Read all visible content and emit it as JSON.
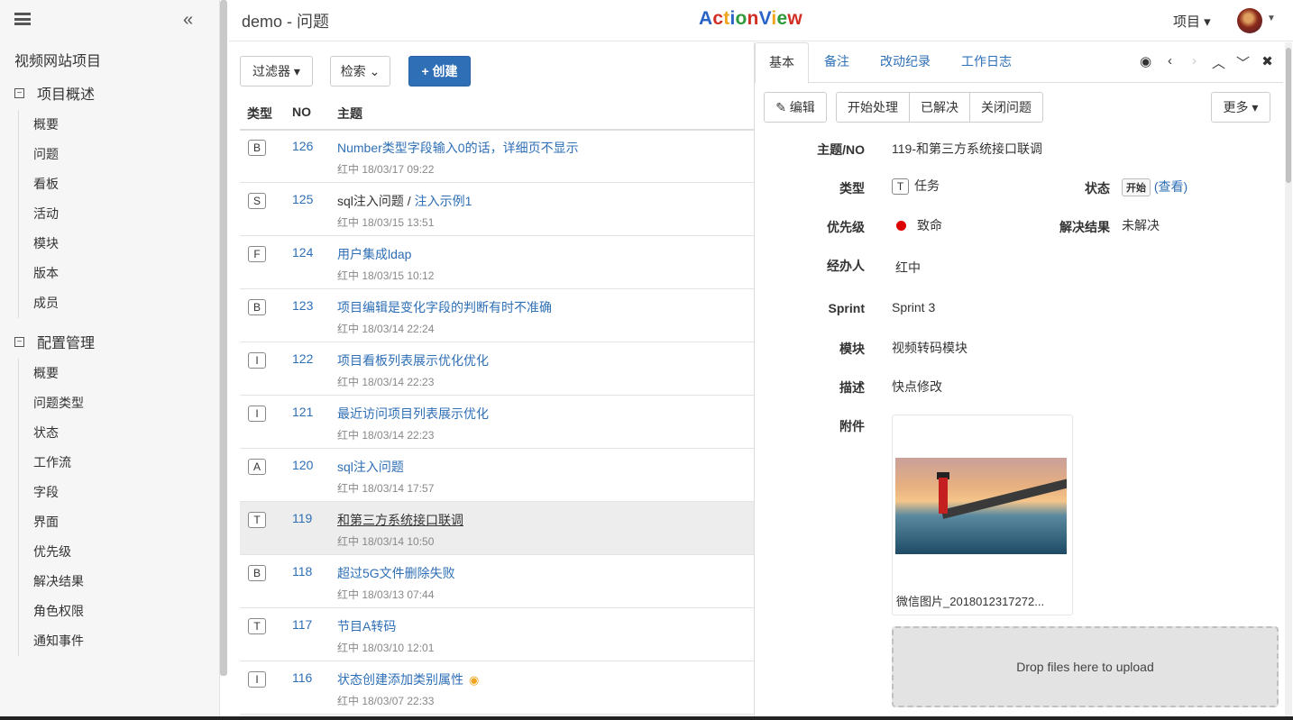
{
  "sidebar": {
    "project_name": "视频网站项目",
    "groups": [
      {
        "label": "项目概述",
        "items": [
          "概要",
          "问题",
          "看板",
          "活动",
          "模块",
          "版本",
          "成员"
        ]
      },
      {
        "label": "配置管理",
        "items": [
          "概要",
          "问题类型",
          "状态",
          "工作流",
          "字段",
          "界面",
          "优先级",
          "解决结果",
          "角色权限",
          "通知事件"
        ]
      }
    ]
  },
  "header": {
    "title": "demo - 问题",
    "logo": [
      "A",
      "c",
      "t",
      "i",
      "o",
      "n",
      "V",
      "i",
      "e",
      "w"
    ],
    "project_menu": "项目 ▾"
  },
  "toolbar": {
    "filter": "过滤器 ▾",
    "search": "检索 ⌄",
    "create": "+ 创建"
  },
  "table": {
    "headers": {
      "type": "类型",
      "no": "NO",
      "title": "主题"
    },
    "rows": [
      {
        "type": "B",
        "no": "126",
        "title": "Number类型字段输入0的话，详细页不显示",
        "meta": "红中  18/03/17 09:22"
      },
      {
        "type": "S",
        "no": "125",
        "title_plain": "sql注入问题 / ",
        "title": "注入示例1",
        "meta": "红中  18/03/15 13:51"
      },
      {
        "type": "F",
        "no": "124",
        "title": "用户集成ldap",
        "meta": "红中  18/03/15 10:12"
      },
      {
        "type": "B",
        "no": "123",
        "title": "项目编辑是变化字段的判断有时不准确",
        "meta": "红中  18/03/14 22:24"
      },
      {
        "type": "I",
        "no": "122",
        "title": "项目看板列表展示优化优化",
        "meta": "红中  18/03/14 22:23"
      },
      {
        "type": "I",
        "no": "121",
        "title": "最近访问项目列表展示优化",
        "meta": "红中  18/03/14 22:23"
      },
      {
        "type": "A",
        "no": "120",
        "title": "sql注入问题",
        "meta": "红中  18/03/14 17:57"
      },
      {
        "type": "T",
        "no": "119",
        "title": "和第三方系统接口联调",
        "meta": "红中  18/03/14 10:50",
        "selected": true
      },
      {
        "type": "B",
        "no": "118",
        "title": "超过5G文件删除失败",
        "meta": "红中  18/03/13 07:44"
      },
      {
        "type": "T",
        "no": "117",
        "title": "节目A转码",
        "meta": "红中  18/03/10 12:01"
      },
      {
        "type": "I",
        "no": "116",
        "title": "状态创建添加类别属性",
        "meta": "红中  18/03/07 22:33",
        "watched": true
      }
    ]
  },
  "detail": {
    "tabs": [
      "基本",
      "备注",
      "改动纪录",
      "工作日志"
    ],
    "buttons": {
      "edit": "✎ 编辑",
      "start": "开始处理",
      "resolved": "已解决",
      "close": "关闭问题",
      "more": "更多 ▾"
    },
    "labels": {
      "title": "主题/NO",
      "type": "类型",
      "status": "状态",
      "priority": "优先级",
      "resolution": "解决结果",
      "assignee": "经办人",
      "sprint": "Sprint",
      "module": "模块",
      "description": "描述",
      "attachments": "附件"
    },
    "values": {
      "title": "119-和第三方系统接口联调",
      "type_badge": "T",
      "type": "任务",
      "status_badge": "开始",
      "status_link": "(查看)",
      "priority": "致命",
      "resolution": "未解决",
      "assignee": "红中",
      "sprint": "Sprint 3",
      "module": "视频转码模块",
      "description": "快点修改"
    },
    "attachment_name": "微信图片_2018012317272...",
    "dropzone": "Drop files here to upload",
    "colors": {
      "priority_dot": "#dd0000",
      "link": "#2e6fb6",
      "primary": "#2e6fb6"
    }
  }
}
